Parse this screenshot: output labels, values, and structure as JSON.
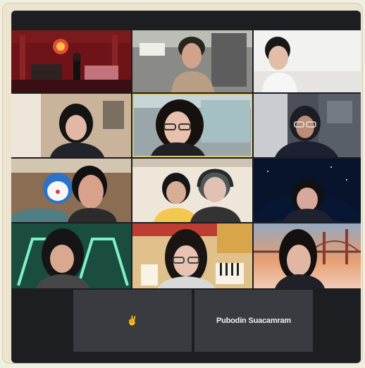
{
  "meeting": {
    "participants": [
      {
        "name": "",
        "kind": "video",
        "scene": "red-stage"
      },
      {
        "name": "",
        "kind": "video",
        "scene": "room-person"
      },
      {
        "name": "",
        "kind": "video",
        "scene": "white-room-person"
      },
      {
        "name": "",
        "kind": "video",
        "scene": "warm-room-person"
      },
      {
        "name": "",
        "kind": "video",
        "scene": "active-speaker"
      },
      {
        "name": "",
        "kind": "video",
        "scene": "dark-room-person"
      },
      {
        "name": "",
        "kind": "video",
        "scene": "cartoon-background"
      },
      {
        "name": "",
        "kind": "video",
        "scene": "two-people"
      },
      {
        "name": "",
        "kind": "video",
        "scene": "space-background"
      },
      {
        "name": "",
        "kind": "video",
        "scene": "green-arches"
      },
      {
        "name": "",
        "kind": "video",
        "scene": "piano-poster"
      },
      {
        "name": "",
        "kind": "video",
        "scene": "sunset-bridge"
      }
    ],
    "bottom_tiles": [
      {
        "label": "✌",
        "type": "reaction"
      },
      {
        "label": "Pubodin Suacamram",
        "type": "name-only"
      }
    ]
  },
  "colors": {
    "meeting_background": "#1d1e21",
    "active_border": "#d9c97a",
    "name_text": "#f1f1f1"
  }
}
